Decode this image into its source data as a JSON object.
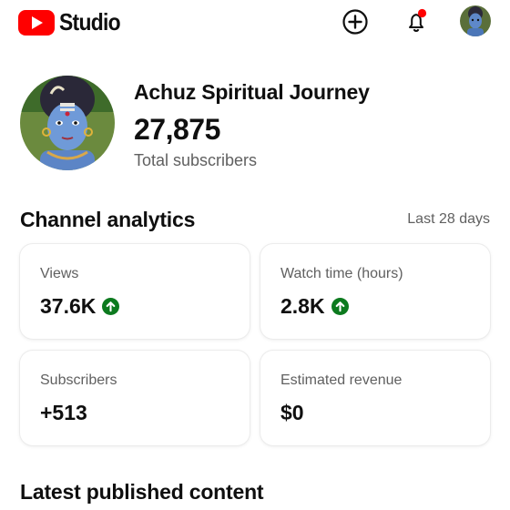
{
  "app": {
    "logo_text": "Studio",
    "brand_color": "#ff0000"
  },
  "header": {
    "icons": [
      "create-icon",
      "notification-bell-icon",
      "account-avatar"
    ],
    "notification_dot_color": "#ff0000"
  },
  "channel": {
    "name": "Achuz Spiritual Journey",
    "subscribers": "27,875",
    "subscribers_label": "Total subscribers"
  },
  "analytics": {
    "title": "Channel analytics",
    "period": "Last 28 days",
    "cards": [
      {
        "label": "Views",
        "value": "37.6K",
        "trend": "up"
      },
      {
        "label": "Watch time (hours)",
        "value": "2.8K",
        "trend": "up"
      },
      {
        "label": "Subscribers",
        "value": "+513"
      },
      {
        "label": "Estimated revenue",
        "value": "$0"
      }
    ],
    "trend_up_color": "#0c7a1e"
  },
  "latest": {
    "title": "Latest published content"
  }
}
